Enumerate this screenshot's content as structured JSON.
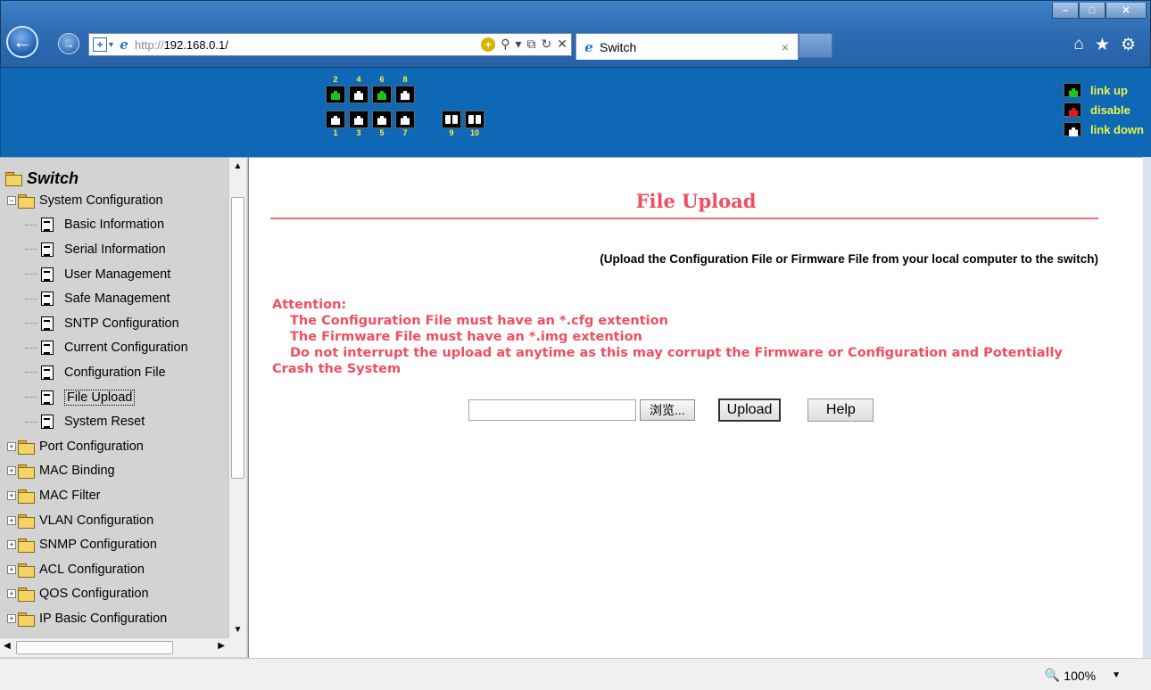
{
  "browser": {
    "address_proto": "http://",
    "address_host": "192.168.0.1/",
    "tab_title": "Switch",
    "tab_close": "×",
    "minimize": "–",
    "maximize": "□",
    "close": "✕",
    "zoom": "100%"
  },
  "header": {
    "top_port_numbers": [
      "2",
      "4",
      "6",
      "8"
    ],
    "bottom_port_numbers": [
      "1",
      "3",
      "5",
      "7",
      "",
      "9",
      "10"
    ],
    "top_port_states": [
      "up",
      "down",
      "up",
      "down"
    ],
    "bottom_port_states": [
      "down",
      "down",
      "down",
      "down"
    ],
    "legend": {
      "link_up": "link up",
      "disable": "disable",
      "link_down": "link down"
    }
  },
  "sidebar": {
    "root": "Switch",
    "system_configuration": "System Configuration",
    "sub_items": [
      "Basic Information",
      "Serial Information",
      "User Management",
      "Safe Management",
      "SNTP Configuration",
      "Current Configuration",
      "Configuration File",
      "File Upload",
      "System Reset"
    ],
    "folders": [
      "Port Configuration",
      "MAC Binding",
      "MAC Filter",
      "VLAN Configuration",
      "SNMP Configuration",
      "ACL Configuration",
      "QOS Configuration",
      "IP Basic Configuration"
    ]
  },
  "main": {
    "title": "File Upload",
    "subtitle": "(Upload the Configuration File or Firmware File from your local computer to the switch)",
    "attention_heading": "Attention:",
    "attention_lines": [
      "The Configuration File must have an *.cfg extention",
      "The Firmware File must have an *.img extention",
      "Do not interrupt the upload at anytime as this may corrupt the Firmware or Configuration and Potentially"
    ],
    "attention_wrap": "Crash the System",
    "browse_label": "浏览...",
    "upload_label": "Upload",
    "help_label": "Help",
    "file_value": ""
  },
  "colors": {
    "header_blue": "#0f68b5",
    "title_red": "#f04e60",
    "legend_text": "#eaf44a",
    "port_up": "#23c316",
    "port_disable": "#e31b1b"
  }
}
